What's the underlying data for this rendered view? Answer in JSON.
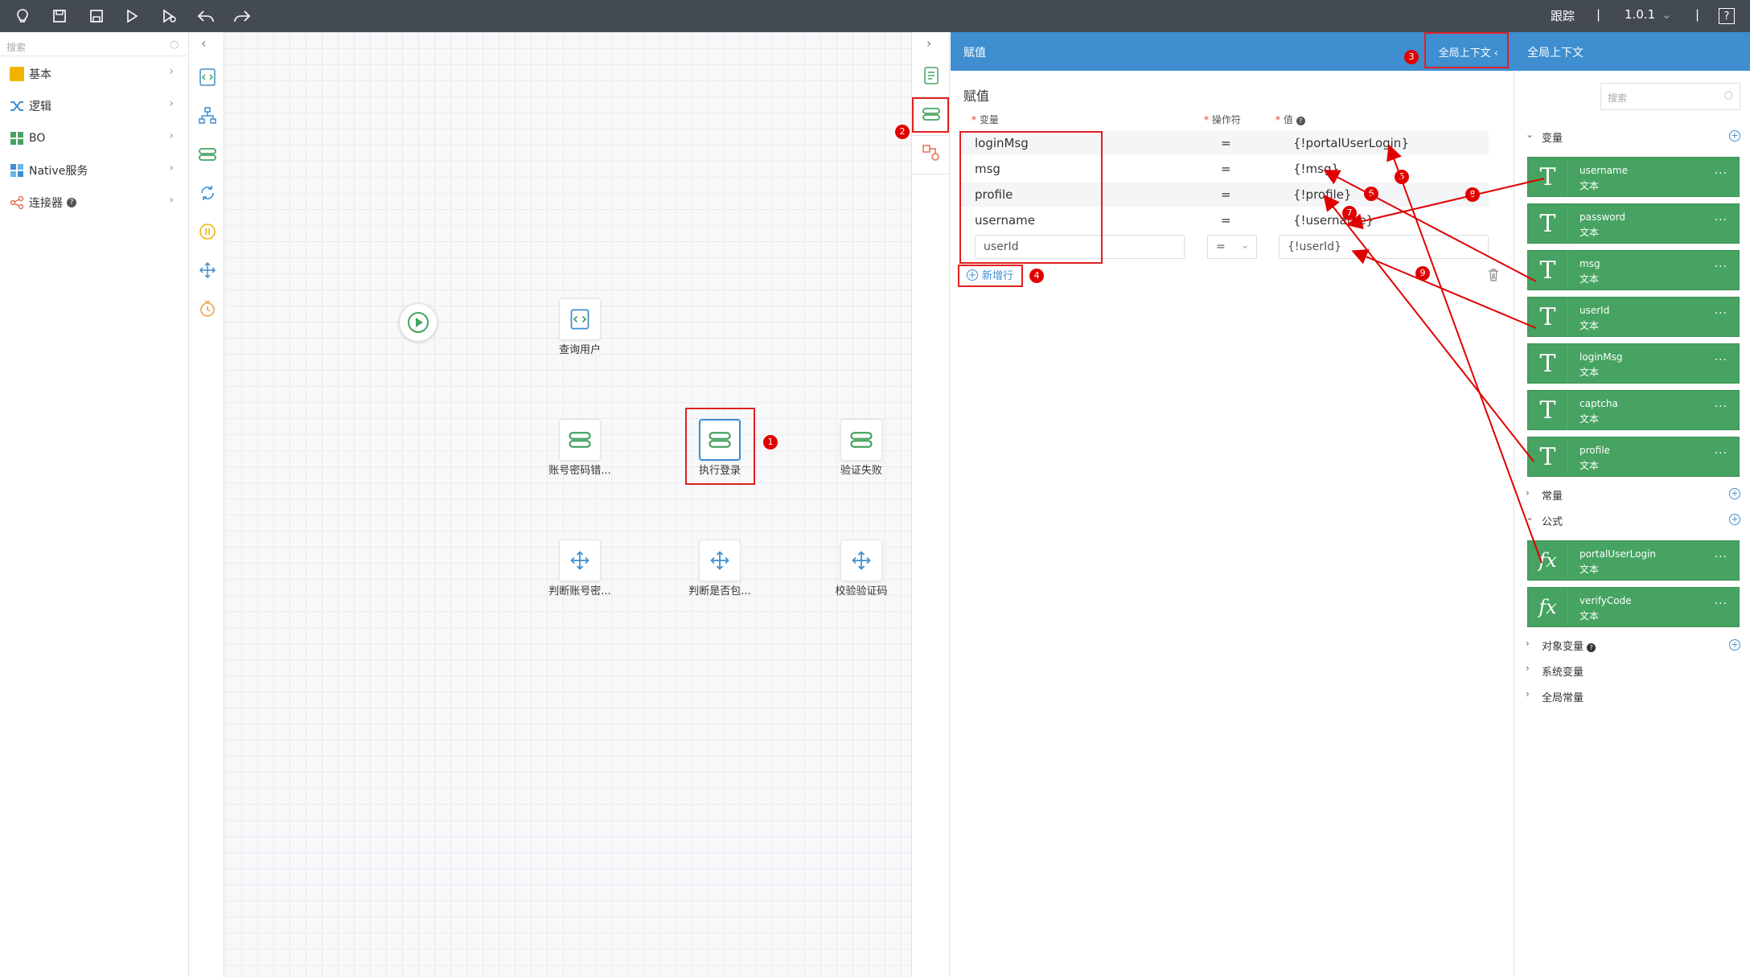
{
  "topbar": {
    "trace_label": "跟踪",
    "separator": "|",
    "version": "1.0.1",
    "help_icon": "?",
    "icons": [
      "bulb-icon",
      "save-icon",
      "save-as-icon",
      "run-icon",
      "debug-run-icon",
      "undo-icon",
      "redo-icon"
    ]
  },
  "left_panel": {
    "search_placeholder": "搜索",
    "categories": [
      {
        "label": "基本",
        "icon": "basic-icon",
        "color": "#f0b400"
      },
      {
        "label": "逻辑",
        "icon": "logic-icon",
        "color": "#3e8ed0"
      },
      {
        "label": "BO",
        "icon": "bo-icon",
        "color": "#46a361"
      },
      {
        "label": "Native服务",
        "icon": "native-service-icon",
        "color": "#3e8ed0"
      },
      {
        "label": "连接器",
        "icon": "connector-icon",
        "color": "#e07050"
      }
    ]
  },
  "canvas": {
    "nodes": [
      {
        "label": "查询用户",
        "type": "script"
      },
      {
        "label": "账号密码错...",
        "type": "assign"
      },
      {
        "label": "执行登录",
        "type": "assign",
        "selected": true
      },
      {
        "label": "验证失败",
        "type": "assign"
      },
      {
        "label": "判断账号密...",
        "type": "decision"
      },
      {
        "label": "判断是否包...",
        "type": "decision"
      },
      {
        "label": "校验验证码",
        "type": "decision"
      }
    ]
  },
  "assign_panel": {
    "header_title": "赋值",
    "header_context_button": "全局上下文",
    "section_title": "赋值",
    "col_variable": "变量",
    "col_operator": "操作符",
    "col_value": "值",
    "required_mark": "*",
    "rows": [
      {
        "variable": "loginMsg",
        "operator": "=",
        "value": "{!portalUserLogin}"
      },
      {
        "variable": "msg",
        "operator": "=",
        "value": "{!msg}"
      },
      {
        "variable": "profile",
        "operator": "=",
        "value": "{!profile}"
      },
      {
        "variable": "username",
        "operator": "=",
        "value": "{!username}"
      }
    ],
    "edit_row": {
      "variable": "userId",
      "operator": "=",
      "value": "{!userId}"
    },
    "add_row_label": "新增行"
  },
  "context_panel": {
    "title": "全局上下文",
    "search_placeholder": "搜索",
    "variables_label": "变量",
    "variables": [
      {
        "name": "username",
        "type": "文本",
        "icon": "T"
      },
      {
        "name": "password",
        "type": "文本",
        "icon": "T"
      },
      {
        "name": "msg",
        "type": "文本",
        "icon": "T"
      },
      {
        "name": "userId",
        "type": "文本",
        "icon": "T"
      },
      {
        "name": "loginMsg",
        "type": "文本",
        "icon": "T"
      },
      {
        "name": "captcha",
        "type": "文本",
        "icon": "T"
      },
      {
        "name": "profile",
        "type": "文本",
        "icon": "T"
      }
    ],
    "constants_label": "常量",
    "formulas_label": "公式",
    "formulas": [
      {
        "name": "portalUserLogin",
        "type": "文本",
        "icon": "fx"
      },
      {
        "name": "verifyCode",
        "type": "文本",
        "icon": "fx"
      }
    ],
    "object_vars_label": "对象变量",
    "system_vars_label": "系统变量",
    "global_constants_label": "全局常量"
  },
  "annotations": {
    "badges": [
      "1",
      "2",
      "3",
      "4",
      "5",
      "6",
      "7",
      "8",
      "9"
    ],
    "color": "#e00000"
  }
}
